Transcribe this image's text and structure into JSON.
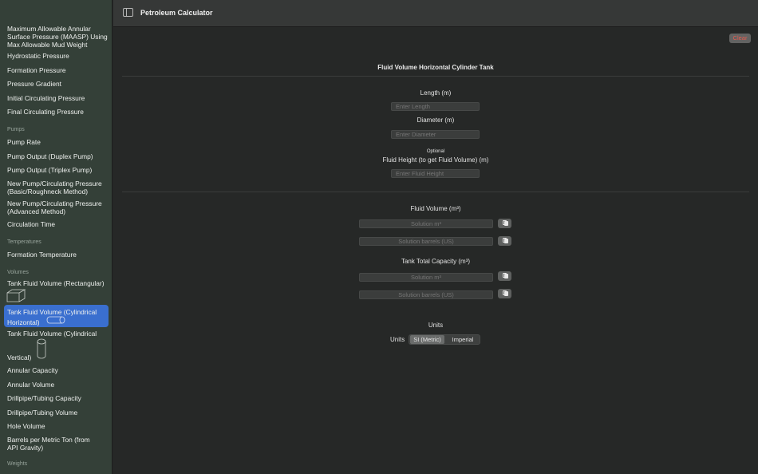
{
  "app": {
    "title": "Petroleum Calculator"
  },
  "sidebar": {
    "items": [
      {
        "label": "Maximum Allowable Annular Surface Pressure (MAASP) Using Max Allowable Mud Weight"
      },
      {
        "label": "Hydrostatic Pressure"
      },
      {
        "label": "Formation Pressure"
      },
      {
        "label": "Pressure Gradient"
      },
      {
        "label": "Initial Circulating Pressure"
      },
      {
        "label": "Final Circulating Pressure"
      },
      {
        "label": "Pump Rate"
      },
      {
        "label": "Pump Output (Duplex Pump)"
      },
      {
        "label": "Pump Output (Triplex Pump)"
      },
      {
        "label": "New Pump/Circulating Pressure (Basic/Roughneck Method)"
      },
      {
        "label": "New Pump/Circulating Pressure (Advanced Method)"
      },
      {
        "label": "Circulation Time"
      },
      {
        "label": "Formation Temperature"
      },
      {
        "label": "Tank Fluid Volume (Rectangular)"
      },
      {
        "label": "Tank Fluid Volume (Cylindrical Horizontal)"
      },
      {
        "label": "Tank Fluid Volume (Cylindrical"
      },
      {
        "label": "Vertical)"
      },
      {
        "label": "Annular Capacity"
      },
      {
        "label": "Annular Volume"
      },
      {
        "label": "Drillpipe/Tubing Capacity"
      },
      {
        "label": "Drillpipe/Tubing Volume"
      },
      {
        "label": "Hole Volume"
      },
      {
        "label": "Barrels per Metric Ton (from API Gravity)"
      }
    ],
    "sections": [
      {
        "label": "Pumps"
      },
      {
        "label": "Temperatures"
      },
      {
        "label": "Volumes"
      },
      {
        "label": "Weights"
      }
    ]
  },
  "main": {
    "clear_label": "Clear",
    "title": "Fluid Volume Horizontal Cylinder Tank",
    "length_label": "Length (m)",
    "length_placeholder": "Enter Length",
    "diameter_label": "Diameter (m)",
    "diameter_placeholder": "Enter Diameter",
    "optional_label": "Optional",
    "fluid_height_label": "Fluid Height (to get Fluid Volume) (m)",
    "fluid_height_placeholder": "Enter Fluid Height",
    "fluid_volume_label": "Fluid Volume (m³)",
    "fluid_volume_m3_placeholder": "Solution m³",
    "fluid_volume_bbl_placeholder": "Solution barrels (US)",
    "tank_capacity_label": "Tank Total Capacity (m³)",
    "tank_capacity_m3_placeholder": "Solution m³",
    "tank_capacity_bbl_placeholder": "Solution barrels (US)",
    "units_heading": "Units",
    "units_label": "Units",
    "units_options": [
      "SI (Metric)",
      "Imperial"
    ],
    "units_selected": "SI (Metric)"
  },
  "colors": {
    "sidebar_bg": "#344038",
    "selection": "#3a6fcf",
    "main_bg": "#262827",
    "clear_text": "#e35b4f"
  }
}
